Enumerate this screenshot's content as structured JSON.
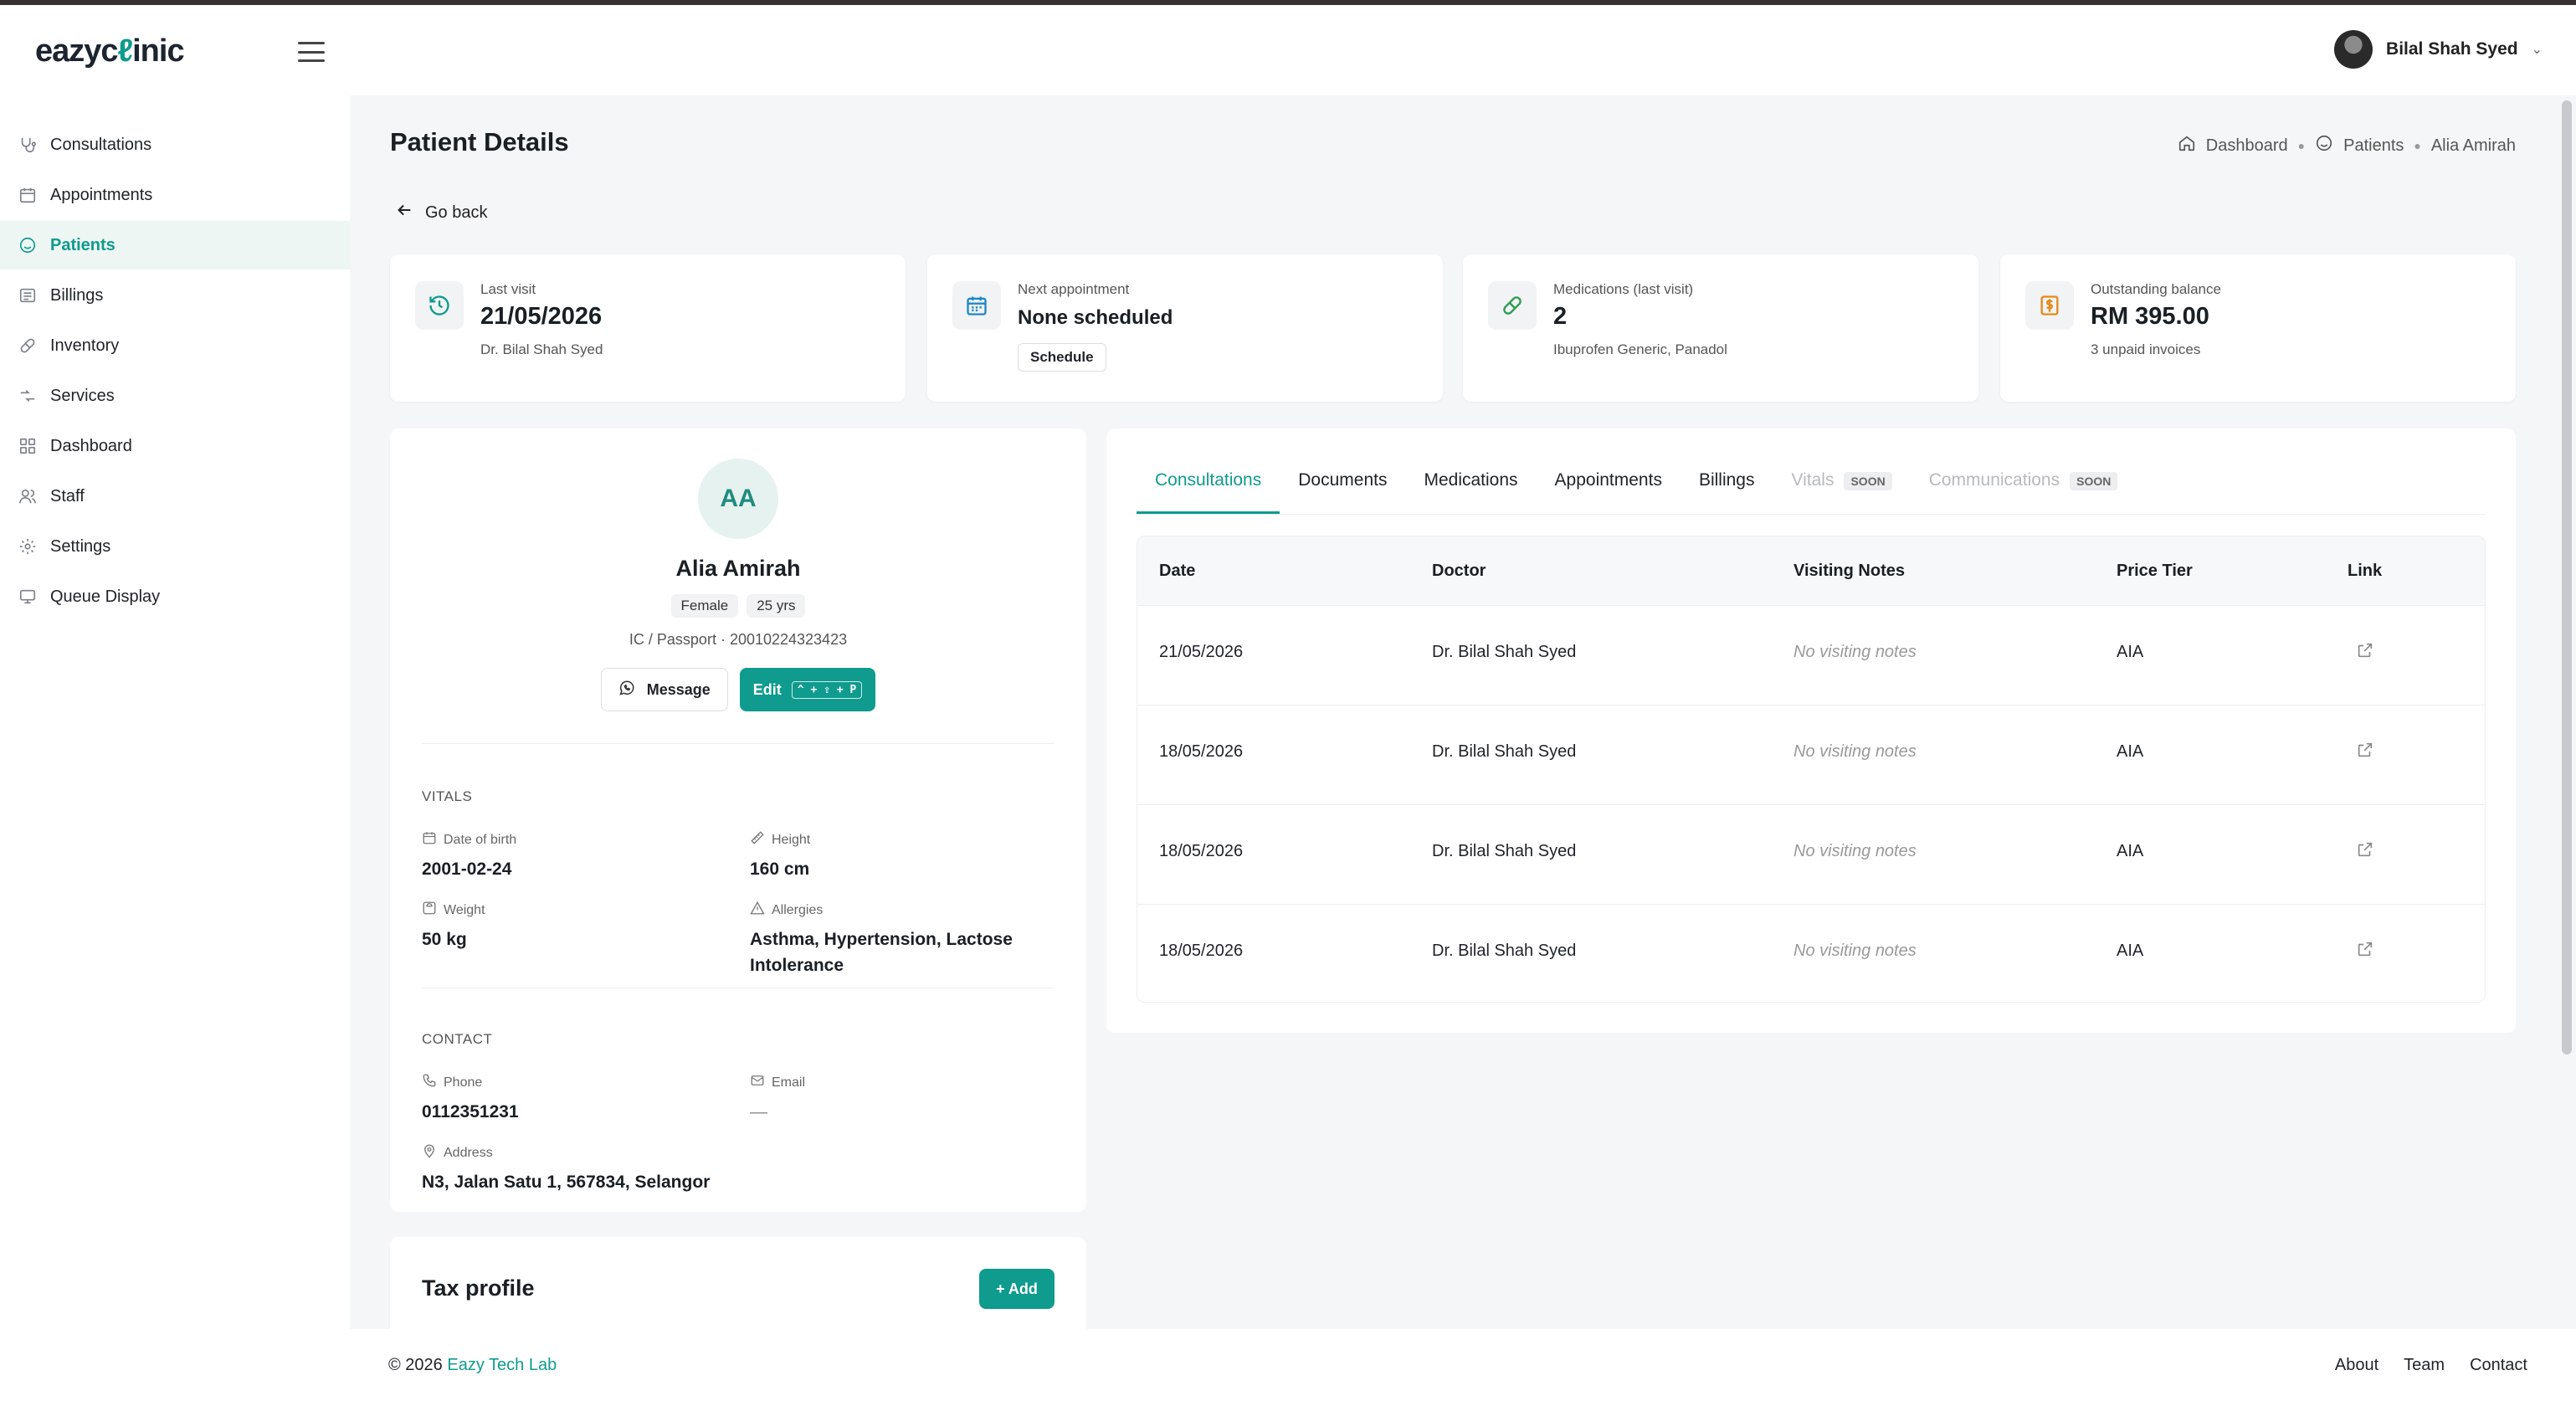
{
  "app": {
    "logo_left": "eazyc",
    "logo_mid": "ℓ",
    "logo_right": "inic"
  },
  "user": {
    "name": "Bilal Shah Syed"
  },
  "sidebar": {
    "items": [
      {
        "label": "Consultations"
      },
      {
        "label": "Appointments"
      },
      {
        "label": "Patients"
      },
      {
        "label": "Billings"
      },
      {
        "label": "Inventory"
      },
      {
        "label": "Services"
      },
      {
        "label": "Dashboard"
      },
      {
        "label": "Staff"
      },
      {
        "label": "Settings"
      },
      {
        "label": "Queue Display"
      }
    ],
    "active_index": 2
  },
  "page": {
    "title": "Patient Details",
    "go_back": "Go back",
    "breadcrumb": [
      "Dashboard",
      "Patients",
      "Alia Amirah"
    ]
  },
  "stats": {
    "last_visit": {
      "label": "Last visit",
      "value": "21/05/2026",
      "sub": "Dr. Bilal Shah Syed"
    },
    "next_appointment": {
      "label": "Next appointment",
      "value": "None scheduled",
      "button": "Schedule"
    },
    "medications": {
      "label": "Medications (last visit)",
      "value": "2",
      "sub": "Ibuprofen Generic, Panadol"
    },
    "balance": {
      "label": "Outstanding balance",
      "value": "RM 395.00",
      "sub": "3 unpaid invoices"
    }
  },
  "profile": {
    "initials": "AA",
    "name": "Alia Amirah",
    "gender": "Female",
    "age": "25 yrs",
    "ic": "IC / Passport · 20010224323423",
    "message_label": "Message",
    "edit_label": "Edit",
    "edit_shortcut": "^ + ⇧ + P",
    "vitals_heading": "VITALS",
    "dob_label": "Date of birth",
    "dob": "2001-02-24",
    "height_label": "Height",
    "height": "160 cm",
    "weight_label": "Weight",
    "weight": "50 kg",
    "allergies_label": "Allergies",
    "allergies": "Asthma, Hypertension, Lactose Intolerance",
    "contact_heading": "CONTACT",
    "phone_label": "Phone",
    "phone": "0112351231",
    "email_label": "Email",
    "email": "—",
    "address_label": "Address",
    "address": "N3, Jalan Satu 1, 567834, Selangor"
  },
  "tax": {
    "title": "Tax profile",
    "add_label": "+ Add"
  },
  "tabs": [
    {
      "label": "Consultations"
    },
    {
      "label": "Documents"
    },
    {
      "label": "Medications"
    },
    {
      "label": "Appointments"
    },
    {
      "label": "Billings"
    },
    {
      "label": "Vitals",
      "badge": "SOON"
    },
    {
      "label": "Communications",
      "badge": "SOON"
    }
  ],
  "table": {
    "headers": [
      "Date",
      "Doctor",
      "Visiting Notes",
      "Price Tier",
      "Link"
    ],
    "rows": [
      {
        "date": "21/05/2026",
        "doctor": "Dr. Bilal Shah Syed",
        "notes": "No visiting notes",
        "tier": "AIA"
      },
      {
        "date": "18/05/2026",
        "doctor": "Dr. Bilal Shah Syed",
        "notes": "No visiting notes",
        "tier": "AIA"
      },
      {
        "date": "18/05/2026",
        "doctor": "Dr. Bilal Shah Syed",
        "notes": "No visiting notes",
        "tier": "AIA"
      },
      {
        "date": "18/05/2026",
        "doctor": "Dr. Bilal Shah Syed",
        "notes": "No visiting notes",
        "tier": "AIA"
      }
    ]
  },
  "footer": {
    "copyright": "© 2026",
    "company": "Eazy Tech Lab",
    "links": [
      "About",
      "Team",
      "Contact"
    ]
  },
  "colors": {
    "accent": "#0f9b8e",
    "page_bg": "#f5f6f7"
  }
}
